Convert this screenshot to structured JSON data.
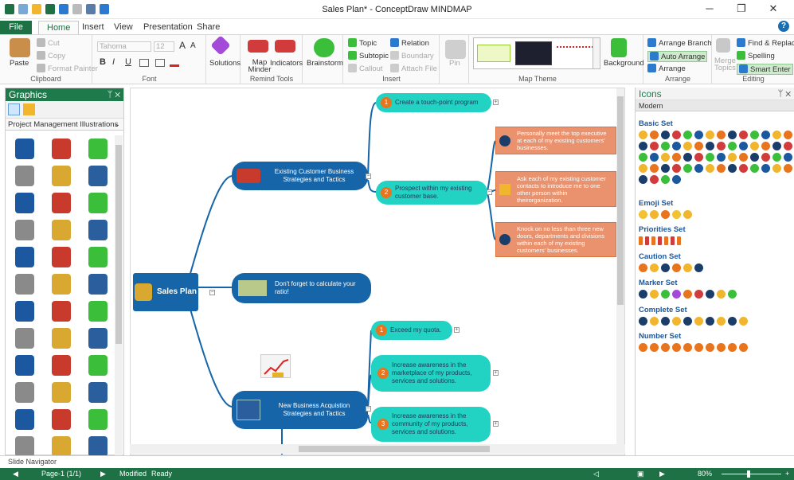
{
  "window": {
    "title": "Sales Plan* - ConceptDraw MINDMAP",
    "minimize": "─",
    "restore": "❐",
    "close": "✕"
  },
  "tabs": [
    {
      "label": "File"
    },
    {
      "label": "Home"
    },
    {
      "label": "Insert"
    },
    {
      "label": "View"
    },
    {
      "label": "Presentation"
    },
    {
      "label": "Share"
    }
  ],
  "help": "?",
  "ribbon": {
    "clipboard": {
      "label": "Clipboard",
      "paste": "Paste",
      "cut": "Cut",
      "copy": "Copy",
      "format_painter": "Format Painter"
    },
    "font": {
      "label": "Font",
      "family": "Tahoma",
      "size": "12",
      "bold": "B",
      "italic": "I",
      "underline": "U",
      "grow": "A",
      "shrink": "A"
    },
    "solutions": {
      "label": "Solutions"
    },
    "remind": {
      "label": "Remind Tools",
      "map_minder": "Map Minder",
      "indicators": "Indicators"
    },
    "brainstorm": {
      "label": "Brainstorm"
    },
    "insert": {
      "label": "Insert",
      "topic": "Topic",
      "subtopic": "Subtopic",
      "callout": "Callout",
      "relation": "Relation",
      "boundary": "Boundary",
      "attach_file": "Attach File"
    },
    "pin": {
      "label": "Pin"
    },
    "theme": {
      "label": "Map Theme"
    },
    "background": {
      "label": "Background"
    },
    "arrange": {
      "label": "Arrange",
      "branch": "Arrange Branch",
      "auto": "Auto Arrange",
      "arrange": "Arrange"
    },
    "editing": {
      "label": "Editing",
      "merge": "Merge Topics",
      "find": "Find & Replace",
      "spelling": "Spelling",
      "smart_enter": "Smart Enter"
    }
  },
  "graphics_panel": {
    "title": "Graphics",
    "pin": "ᛘ ✕",
    "library": "Project Management Illustrations"
  },
  "mindmap": {
    "root": "Sales Plan",
    "existing": "Existing Customer Business Strategies and Tactics",
    "touchpoint": "Create a touch-point program",
    "prospect": "Prospect within my existing customer base.",
    "visit": "Personally meet the top executive at each of my existing customers' businesses.",
    "ask": "Ask each of my existing customer contacts to introduce me to one other person within theirorganization.",
    "knock": "Knock on no less than three new doors, departments and divisions within each of my existing customers' businesses.",
    "calc": "Don't forget to calculate your ratio!",
    "newbiz": "New Business Acquistion Strategies and Tactics",
    "quota": "Exceed my quota.",
    "market": "Increase awareness in the marketplace of my products, services and solutions.",
    "community": "Increase awareness in the community of my products, services and solutions.",
    "badges": [
      "1",
      "2",
      "1",
      "2",
      "3"
    ]
  },
  "icons_panel": {
    "title": "Icons",
    "pin": "ᛘ ✕",
    "tab": "Modern",
    "sets": [
      "Basic Set",
      "Emoji Set",
      "Priorities Set",
      "Caution Set",
      "Marker Set",
      "Complete Set",
      "Number Set"
    ]
  },
  "slide_navigator": "Slide Navigator",
  "status": {
    "page": "Page-1 (1/1)",
    "modified": "Modified",
    "ready": "Ready",
    "zoom": "80%"
  },
  "colors": {
    "accent": "#1e7145",
    "topic_blue": "#1565a8",
    "topic_teal": "#22d3c4",
    "note_orange": "#e9926d"
  }
}
